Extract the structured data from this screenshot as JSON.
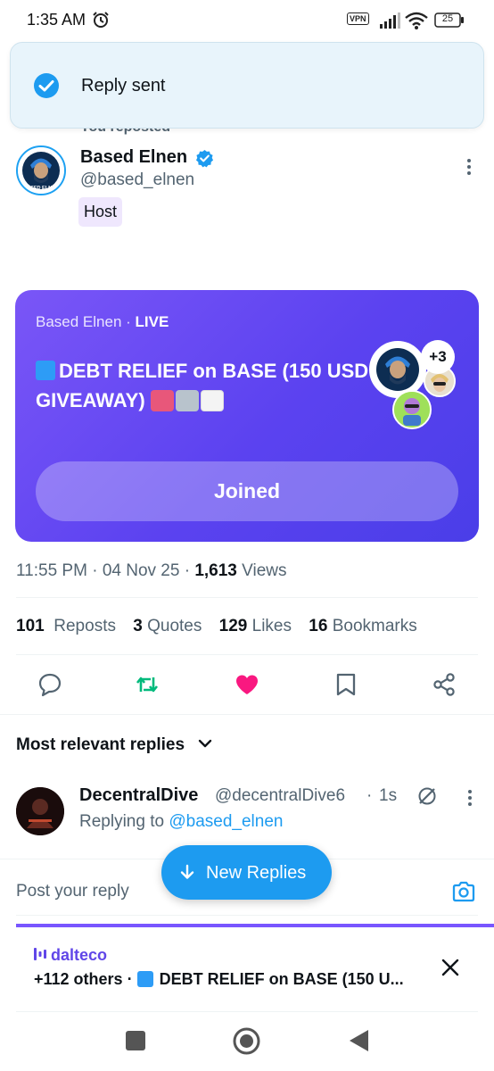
{
  "status": {
    "time": "1:35 AM",
    "vpn": "VPN",
    "battery": "25"
  },
  "toast": {
    "text": "Reply sent"
  },
  "post": {
    "reposted_label": "You reposted",
    "author_name": "Based Elnen",
    "author_handle": "@based_elnen",
    "role_badge": "Host",
    "avatar_text": "BASED ELNEN"
  },
  "space_card": {
    "host": "Based Elnen ·",
    "live": "LIVE",
    "title": "DEBT RELIEF on BASE (150 USD GIVEAWAY)",
    "extra_count": "+3",
    "button": "Joined"
  },
  "meta": {
    "time": "11:55 PM",
    "sep1": " · ",
    "date": "04 Nov 25",
    "sep2": " · ",
    "views_count": "1,613",
    "views_label": " Views"
  },
  "stats": [
    {
      "count": "101",
      "label": "Reposts"
    },
    {
      "count": "3",
      "label": "Quotes"
    },
    {
      "count": "129",
      "label": "Likes"
    },
    {
      "count": "16",
      "label": "Bookmarks"
    }
  ],
  "actions": {
    "reply_icon": "reply-icon",
    "repost_icon": "repost-icon",
    "like_icon": "heart-icon",
    "bookmark_icon": "bookmark-icon",
    "share_icon": "share-icon"
  },
  "colors": {
    "accent": "#1d9bf0",
    "repost_green": "#00ba7c",
    "like_pink": "#f91880",
    "space_purple": "#6046e8"
  },
  "replies": {
    "sort_label": "Most relevant replies",
    "items": [
      {
        "name": "DecentralDive",
        "handle": "@decentralDive6",
        "sep": "·",
        "time": "1s",
        "replying_prefix": "Replying to ",
        "replying_to": "@based_elnen"
      }
    ]
  },
  "composer": {
    "placeholder": "Post your reply"
  },
  "new_replies": {
    "label": "New Replies"
  },
  "dock": {
    "host": "dalteco",
    "line": "+112 others · ",
    "title": "DEBT RELIEF on BASE (150 U..."
  }
}
